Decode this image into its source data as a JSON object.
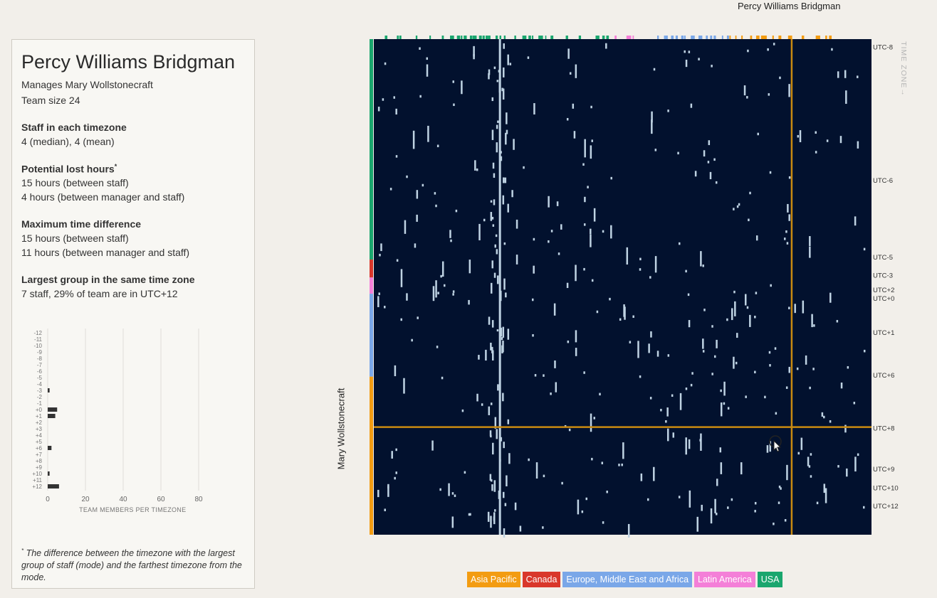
{
  "manager_label": "Percy Williams Bridgman",
  "side_label": "Mary Wollstonecraft",
  "panel": {
    "title": "Percy Williams Bridgman",
    "manages": "Manages Mary Wollstonecraft",
    "team_size": "Team size 24",
    "staff_heading": "Staff in each timezone",
    "staff_value": "4 (median), 4 (mean)",
    "lost_heading": "Potential lost hours",
    "lost_star": "*",
    "lost_staff": "15 hours (between staff)",
    "lost_manager": "4 hours (between manager and staff)",
    "maxdiff_heading": "Maximum time difference",
    "maxdiff_staff": "15 hours (between staff)",
    "maxdiff_manager": "11 hours (between manager and staff)",
    "largest_heading": "Largest group in the same time zone",
    "largest_value": "7 staff, 29% of team are in UTC+12",
    "footnote_star": "*",
    "footnote": " The difference between the timezone with the largest group of staff (mode) and the farthest timezone from the mode."
  },
  "histogram": {
    "categories": [
      "-12",
      "-11",
      "-10",
      "-9",
      "-8",
      "-7",
      "-6",
      "-5",
      "-4",
      "-3",
      "-2",
      "-1",
      "+0",
      "+1",
      "+2",
      "+3",
      "+4",
      "+5",
      "+6",
      "+7",
      "+8",
      "+9",
      "+10",
      "+11",
      "+12"
    ],
    "values": [
      0,
      0,
      0,
      0,
      0,
      0,
      0,
      0,
      0,
      1,
      0,
      0,
      5,
      4,
      0,
      0,
      0,
      0,
      2,
      0,
      0,
      0,
      1,
      0,
      6
    ],
    "x_ticks": [
      0,
      20,
      40,
      60,
      80
    ],
    "x_max": 90,
    "xlabel": "TEAM MEMBERS PER TIMEZONE",
    "bar_color": "#333333",
    "grid_color": "#e1ded8"
  },
  "matrix": {
    "timezone_axis_label": "TIME ZONE→",
    "timezone_labels": [
      {
        "label": "UTC-8",
        "row": 0.5
      },
      {
        "label": "UTC-6",
        "row": 8.3
      },
      {
        "label": "UTC-5",
        "row": 12.8
      },
      {
        "label": "UTC-3",
        "row": 13.85
      },
      {
        "label": "UTC+2",
        "row": 14.7
      },
      {
        "label": "UTC+0",
        "row": 15.2
      },
      {
        "label": "UTC+1",
        "row": 17.2
      },
      {
        "label": "UTC+6",
        "row": 19.7
      },
      {
        "label": "UTC+8",
        "row": 22.8
      },
      {
        "label": "UTC+9",
        "row": 25.2
      },
      {
        "label": "UTC+10",
        "row": 26.3
      },
      {
        "label": "UTC+12",
        "row": 27.35
      }
    ],
    "row_regions": [
      {
        "region": "USA",
        "from": 0,
        "to": 12.9
      },
      {
        "region": "Canada",
        "from": 12.9,
        "to": 13.95
      },
      {
        "region": "Latin America",
        "from": 13.95,
        "to": 14.75
      },
      {
        "region": "Latin America",
        "from": 14.75,
        "to": 14.9
      },
      {
        "region": "Europe, Middle East and Africa",
        "from": 14.9,
        "to": 19.75
      },
      {
        "region": "Asia Pacific",
        "from": 19.75,
        "to": 29
      }
    ],
    "rows": 29,
    "cols": 29,
    "highlight_row": 22.7,
    "highlight_col": 24.35,
    "bright_col": 7.35,
    "background": "#02112e",
    "cell_color": "#bfd3e3",
    "highlight_color": "#c98a10"
  },
  "legend": [
    {
      "label": "Asia Pacific",
      "color": "#f39c12"
    },
    {
      "label": "Canada",
      "color": "#d9372b"
    },
    {
      "label": "Europe, Middle East and Africa",
      "color": "#7aa7e8"
    },
    {
      "label": "Latin America",
      "color": "#f47fd8"
    },
    {
      "label": "USA",
      "color": "#1aa66e"
    }
  ]
}
